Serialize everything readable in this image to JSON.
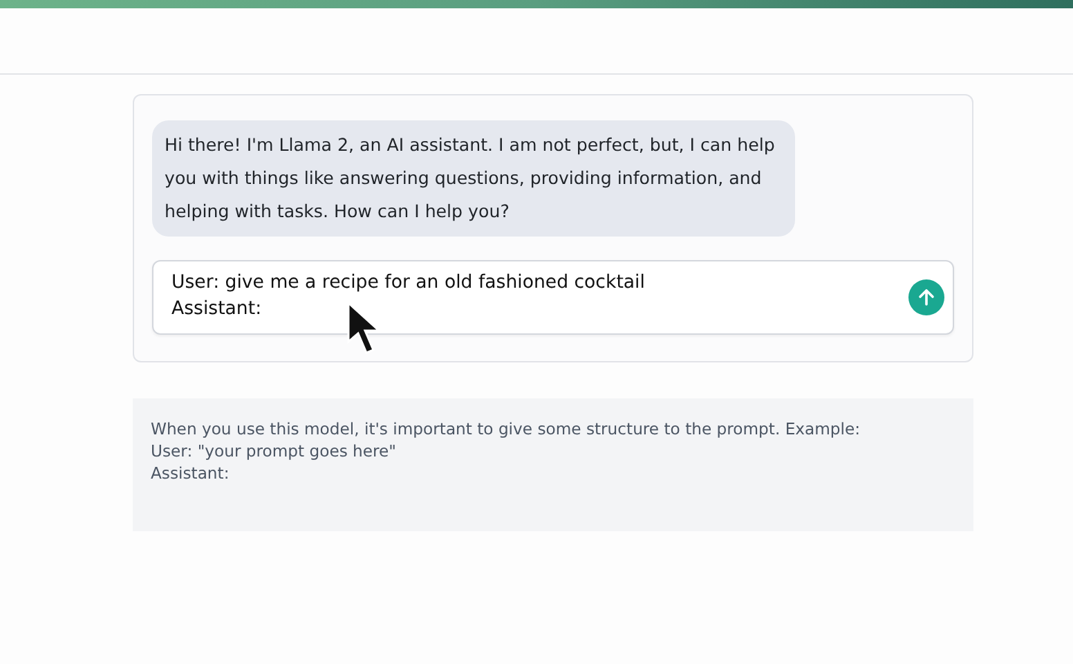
{
  "chat": {
    "messages": [
      {
        "text": "Hi there! I'm Llama 2, an AI assistant. I am not perfect, but, I can help you with things like answering questions, providing information, and helping with tasks. How can I help you?"
      }
    ],
    "input": {
      "value": "User: give me a recipe for an old fashioned cocktail\nAssistant:"
    }
  },
  "note": {
    "text": "When you use this model, it's important to give some structure to the prompt. Example:\nUser: \"your prompt goes here\"\nAssistant:"
  }
}
